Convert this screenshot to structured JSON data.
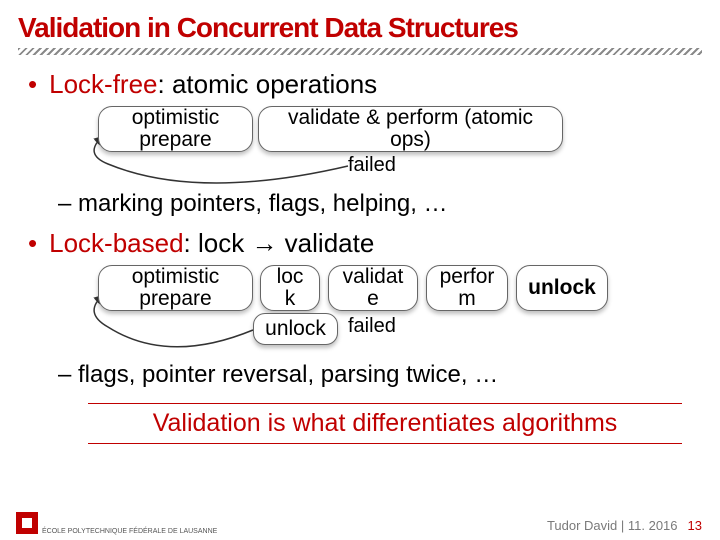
{
  "title": "Validation in Concurrent Data Structures",
  "bullet1": {
    "hl": "Lock-free",
    "rest": ": atomic operations"
  },
  "flow1": {
    "box1_l1": "optimistic",
    "box1_l2": "prepare",
    "box2_l1": "validate & perform (atomic",
    "box2_l2": "ops)",
    "failed": "failed"
  },
  "sub1": "– marking pointers, flags, helping, …",
  "bullet2": {
    "hl": "Lock-based",
    "mid": ": lock ",
    "arrow": "→",
    "tail": " validate"
  },
  "flow2": {
    "box1_l1": "optimistic",
    "box1_l2": "prepare",
    "box2_l1": "loc",
    "box2_l2": "k",
    "box3_l1": "validat",
    "box3_l2": "e",
    "box4_l1": "perfor",
    "box4_l2": "m",
    "box5": "unlock",
    "unlock": "unlock",
    "failed": "failed"
  },
  "sub2": "– flags, pointer reversal, parsing twice, …",
  "highlight": "Validation is what differentiates algorithms",
  "footer": {
    "author_date": "Tudor David | 11. 2016",
    "page": "13"
  },
  "logo_text": "ÉCOLE POLYTECHNIQUE\nFÉDÉRALE DE LAUSANNE"
}
